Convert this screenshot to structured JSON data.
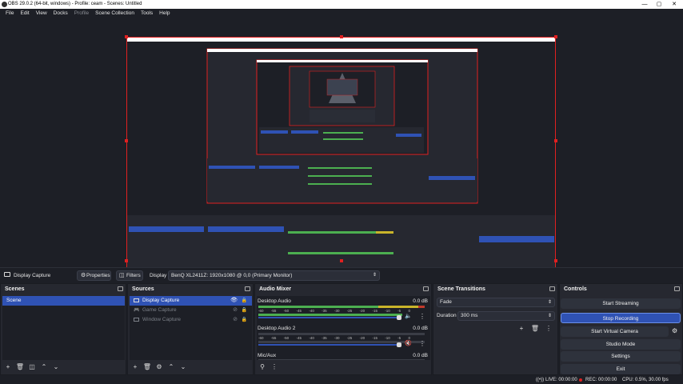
{
  "window": {
    "title": "OBS 29.0.2 (64-bit, windows) - Profile: ceam - Scenes: Untitled",
    "minimize": "—",
    "maximize": "▢",
    "close": "✕"
  },
  "menu": [
    "File",
    "Edit",
    "View",
    "Docks",
    "Profile",
    "Scene Collection",
    "Tools",
    "Help"
  ],
  "context_bar": {
    "source": "Display Capture",
    "properties": "Properties",
    "filters": "Filters",
    "display_label": "Display",
    "display_value": "BenQ XL2411Z: 1920x1080 @ 0,0 (Primary Monitor)"
  },
  "scenes": {
    "title": "Scenes",
    "items": [
      "Scene"
    ]
  },
  "sources": {
    "title": "Sources",
    "items": [
      "Display Capture",
      "Game Capture",
      "Window Capture"
    ]
  },
  "audio_mixer": {
    "title": "Audio Mixer",
    "channels": [
      {
        "name": "Desktop Audio",
        "db": "0.0 dB",
        "ticks": [
          "-60",
          "-55",
          "-50",
          "-45",
          "-40",
          "-35",
          "-30",
          "-25",
          "-20",
          "-15",
          "-10",
          "-5",
          "0"
        ]
      },
      {
        "name": "Desktop Audio 2",
        "db": "0.0 dB",
        "ticks": [
          "-60",
          "-55",
          "-50",
          "-45",
          "-40",
          "-35",
          "-30",
          "-25",
          "-20",
          "-15",
          "-10",
          "-5",
          "0"
        ]
      },
      {
        "name": "Mic/Aux",
        "db": "0.0 dB"
      }
    ]
  },
  "scene_transitions": {
    "title": "Scene Transitions",
    "transition": "Fade",
    "duration_label": "Duration",
    "duration_value": "300 ms"
  },
  "controls": {
    "title": "Controls",
    "buttons": [
      "Start Streaming",
      "Stop Recording",
      "Start Virtual Camera",
      "Studio Mode",
      "Settings",
      "Exit"
    ]
  },
  "status": {
    "live": "LIVE: 00:00:00",
    "rec": "REC: 00:00:00",
    "cpu": "CPU: 0.5%, 30.00 fps"
  },
  "colors": {
    "accent": "#2f52b4",
    "selection_border": "#e02020",
    "meter_green": "#4caf50",
    "meter_yellow": "#c9b42a",
    "meter_red": "#c0392b"
  }
}
